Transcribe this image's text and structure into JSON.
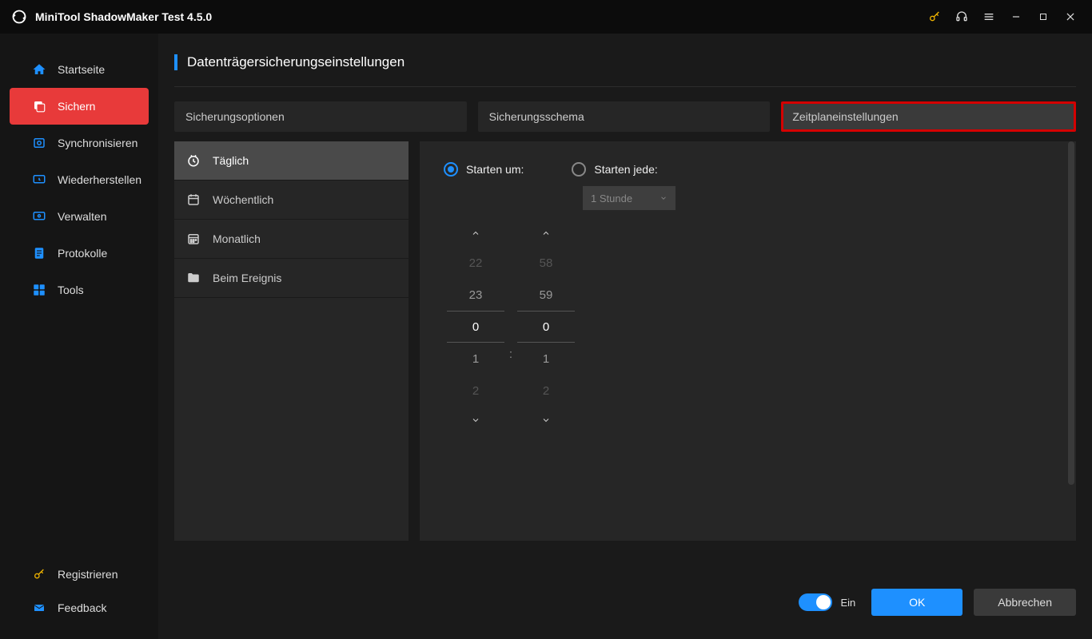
{
  "titlebar": {
    "app_title": "MiniTool ShadowMaker Test 4.5.0"
  },
  "sidebar": {
    "items": [
      {
        "label": "Startseite"
      },
      {
        "label": "Sichern"
      },
      {
        "label": "Synchronisieren"
      },
      {
        "label": "Wiederherstellen"
      },
      {
        "label": "Verwalten"
      },
      {
        "label": "Protokolle"
      },
      {
        "label": "Tools"
      }
    ],
    "bottom": [
      {
        "label": "Registrieren"
      },
      {
        "label": "Feedback"
      }
    ]
  },
  "page": {
    "title": "Datenträgersicherungseinstellungen"
  },
  "tabs": [
    {
      "label": "Sicherungsoptionen"
    },
    {
      "label": "Sicherungsschema"
    },
    {
      "label": "Zeitplaneinstellungen"
    }
  ],
  "subtabs": [
    {
      "label": "Täglich"
    },
    {
      "label": "Wöchentlich"
    },
    {
      "label": "Monatlich"
    },
    {
      "label": "Beim Ereignis"
    }
  ],
  "schedule": {
    "start_at_label": "Starten um:",
    "start_every_label": "Starten jede:",
    "interval_selected": "1 Stunde",
    "hours": {
      "minus2": "22",
      "minus1": "23",
      "sel": "0",
      "plus1": "1",
      "plus2": "2"
    },
    "minutes": {
      "minus2": "58",
      "minus1": "59",
      "sel": "0",
      "plus1": "1",
      "plus2": "2"
    },
    "colon": ":"
  },
  "footer": {
    "toggle_label": "Ein",
    "ok": "OK",
    "cancel": "Abbrechen"
  }
}
